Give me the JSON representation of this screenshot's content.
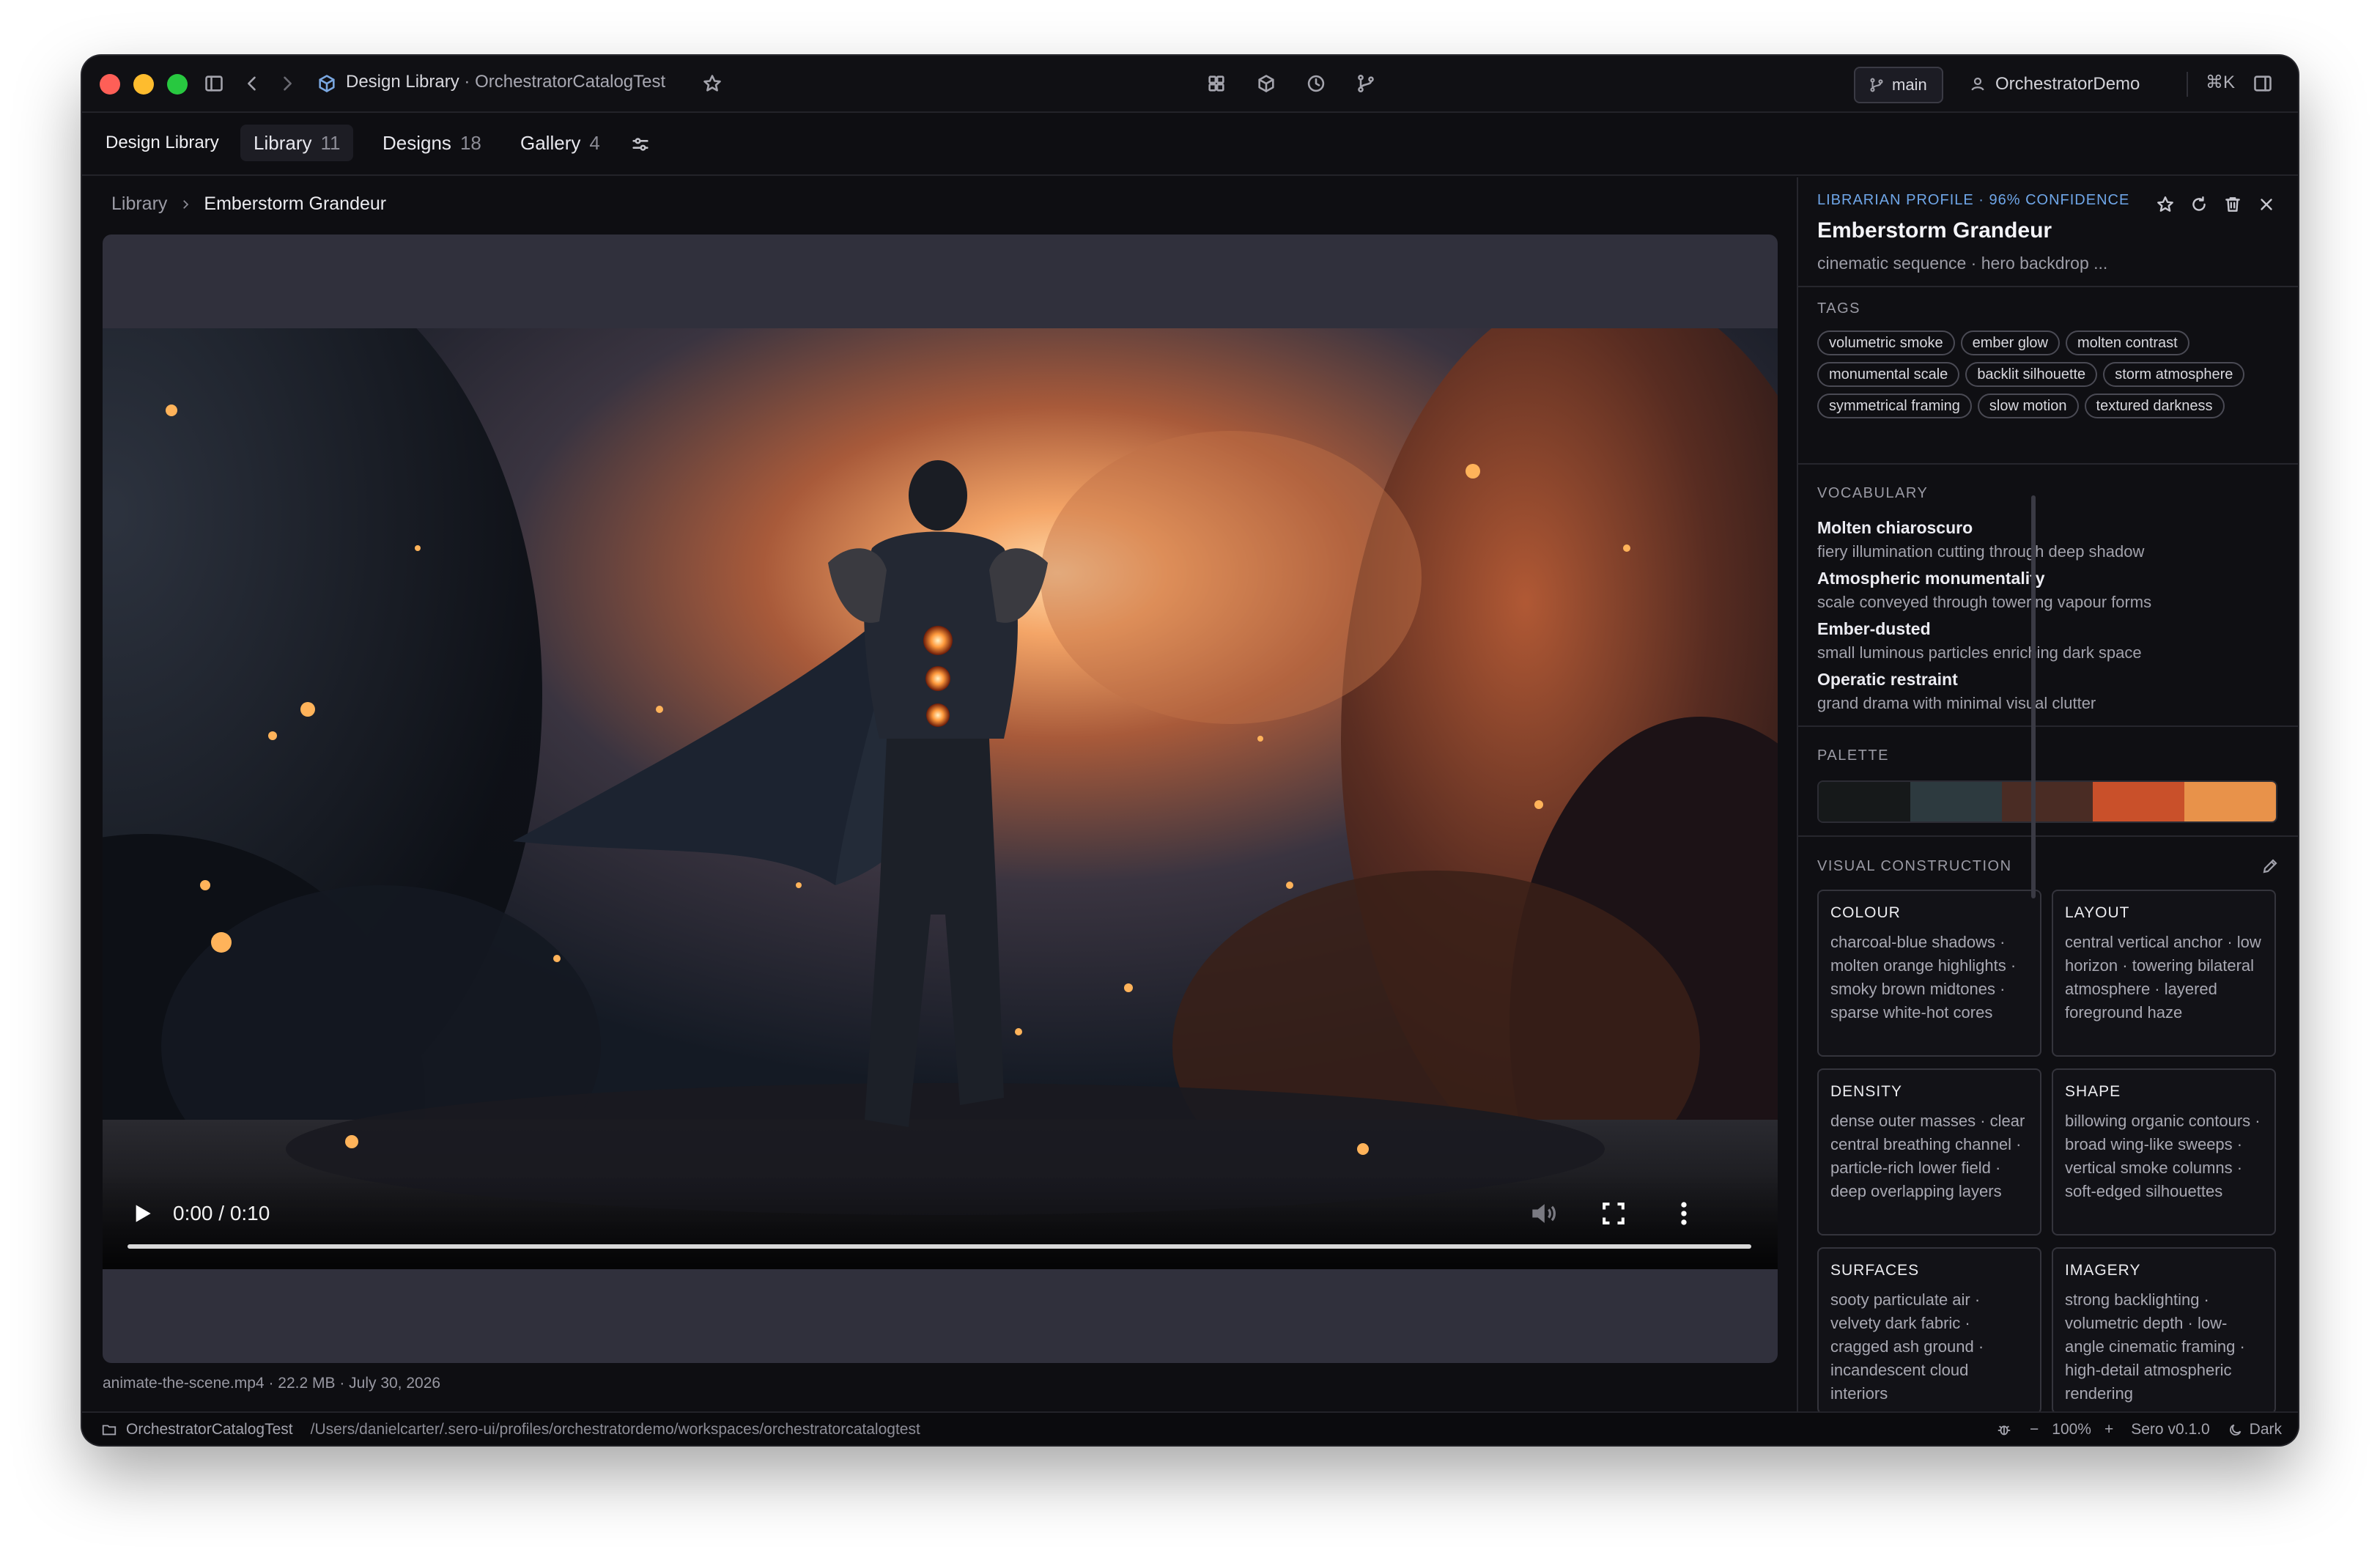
{
  "window": {
    "title_app": "Design Library",
    "title_sep": " · ",
    "title_workspace": "OrchestratorCatalogTest",
    "branch": "main",
    "user": "OrchestratorDemo",
    "shortcut": "⌘K"
  },
  "tabs": {
    "home": "Design Library",
    "items": [
      {
        "label": "Library",
        "count": "11"
      },
      {
        "label": "Designs",
        "count": "18"
      },
      {
        "label": "Gallery",
        "count": "4"
      }
    ]
  },
  "breadcrumb": {
    "root": "Library",
    "current": "Emberstorm Grandeur"
  },
  "video": {
    "time": "0:00 / 0:10",
    "progress": 0.0,
    "file_meta": "animate-the-scene.mp4 · 22.2 MB · July 30, 2026"
  },
  "profile": {
    "eyebrow": "LIBRARIAN PROFILE · 96% CONFIDENCE",
    "title": "Emberstorm Grandeur",
    "subtitle": "cinematic sequence · hero backdrop ...",
    "tags_label": "TAGS",
    "tags": [
      "volumetric smoke",
      "ember glow",
      "molten contrast",
      "monumental scale",
      "backlit silhouette",
      "storm atmosphere",
      "symmetrical framing",
      "slow motion",
      "textured darkness"
    ],
    "vocab_label": "VOCABULARY",
    "vocab": [
      {
        "term": "Molten chiaroscuro",
        "desc": "fiery illumination cutting through deep shadow"
      },
      {
        "term": "Atmospheric monumentality",
        "desc": "scale conveyed through towering vapour forms"
      },
      {
        "term": "Ember-dusted",
        "desc": "small luminous particles enriching dark space"
      },
      {
        "term": "Operatic restraint",
        "desc": "grand drama with minimal visual clutter"
      }
    ],
    "palette_label": "PALETTE",
    "palette": [
      "#16191a",
      "#2d3a3f",
      "#4a2c24",
      "#c9502a",
      "#e8924a"
    ],
    "vc_label": "VISUAL CONSTRUCTION",
    "vc": [
      {
        "title": "COLOUR",
        "text": "charcoal-blue shadows · molten orange highlights · smoky brown midtones · sparse white-hot cores"
      },
      {
        "title": "LAYOUT",
        "text": "central vertical anchor · low horizon · towering bilateral atmosphere · layered foreground haze"
      },
      {
        "title": "DENSITY",
        "text": "dense outer masses · clear central breathing channel · particle-rich lower field · deep overlapping layers"
      },
      {
        "title": "SHAPE",
        "text": "billowing organic contours · broad wing-like sweeps · vertical smoke columns · soft-edged silhouettes"
      },
      {
        "title": "SURFACES",
        "text": "sooty particulate air · velvety dark fabric · cragged ash ground · incandescent cloud interiors"
      },
      {
        "title": "IMAGERY",
        "text": "strong backlighting · volumetric depth · low-angle cinematic framing · high-detail atmospheric rendering"
      }
    ]
  },
  "status": {
    "workspace": "OrchestratorCatalogTest",
    "path": "/Users/danielcarter/.sero-ui/profiles/orchestratordemo/workspaces/orchestratorcatalogtest",
    "zoom_minus": "−",
    "zoom": "100%",
    "zoom_plus": "+",
    "version": "Sero v0.1.0",
    "theme": "Dark"
  }
}
